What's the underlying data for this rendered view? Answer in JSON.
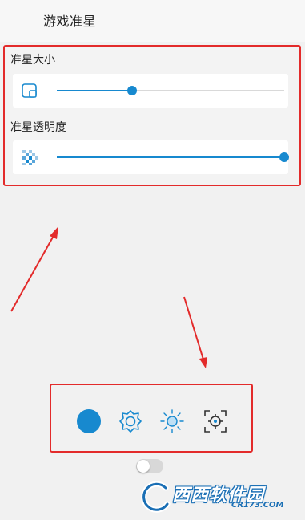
{
  "header": {
    "title": "游戏准星"
  },
  "crosshair_settings": {
    "size": {
      "label": "准星大小",
      "icon": "square-frame-icon",
      "value_fraction": 0.33
    },
    "opacity": {
      "label": "准星透明度",
      "icon": "checkerboard-icon",
      "value_fraction": 1.0
    }
  },
  "styles": [
    {
      "name": "solid-dot",
      "icon": "filled-circle-icon",
      "selected": true
    },
    {
      "name": "gear",
      "icon": "gear-icon",
      "selected": false
    },
    {
      "name": "sun",
      "icon": "sun-icon",
      "selected": false
    },
    {
      "name": "target",
      "icon": "target-icon",
      "selected": false
    }
  ],
  "toggle": {
    "on": false
  },
  "colors": {
    "accent": "#1789cf",
    "highlight_box": "#e32b2b",
    "arrow": "#e32b2b"
  },
  "watermark": {
    "text": "西西软件园",
    "url": "CR173.COM"
  }
}
